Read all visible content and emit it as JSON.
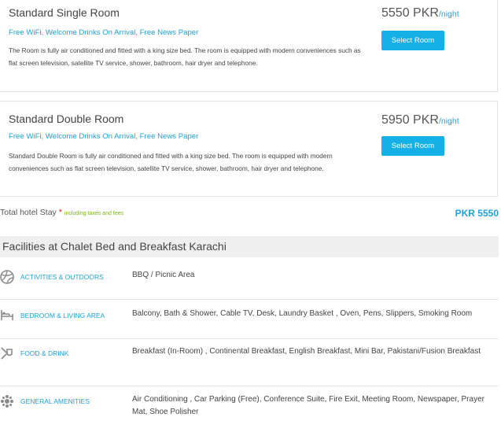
{
  "rooms": [
    {
      "name": "Standard Single Room",
      "amenities": "Free WiFi, Welcome Drinks On Arrival, Free News Paper",
      "description": "The Room is fully air conditioned and fitted with a king size bed. The room is equipped with modern conveniences such as flat screen television, satellite TV service, shower, bathroom, hair dryer and telephone.",
      "price": "5550 PKR",
      "per": "/night",
      "button": "Select Room"
    },
    {
      "name": "Standard Double Room",
      "amenities": "Free WiFi, Welcome Drinks On Arrival, Free News Paper",
      "description": "Standard Double Room is fully air conditioned and fitted with a king size bed. The room is equipped with modern conveniences such as flat screen television, satellite TV service, shower, bathroom, hair dryer and telephone.",
      "price": "5950 PKR",
      "per": "/night",
      "button": "Select Room"
    }
  ],
  "total": {
    "label": "Total hotel Stay",
    "star": "*",
    "note": "including taxes and fees",
    "value": "PKR 5550"
  },
  "facilities": {
    "title": "Facilities at Chalet Bed and Breakfast Karachi",
    "categories": [
      {
        "icon": "beach-ball-icon",
        "name": "ACTIVITIES & OUTDOORS",
        "items": "BBQ / Picnic Area"
      },
      {
        "icon": "bed-icon",
        "name": "BEDROOM & LIVING AREA",
        "items": "Balcony, Bath & Shower, Cable TV, Desk, Laundry Basket , Oven, Pens, Slippers, Smoking Room"
      },
      {
        "icon": "food-icon",
        "name": "FOOD & DRINK",
        "items": "Breakfast (In-Room) , Continental Breakfast, English Breakfast, Mini Bar, Pakistani/Fusion Breakfast"
      },
      {
        "icon": "amenities-icon",
        "name": "GENERAL AMENITIES",
        "items": "Air Conditioning , Car Parking (Free), Conference Suite, Fire Exit, Meeting Room, Newspaper, Prayer Mat, Shoe Polisher"
      }
    ]
  },
  "colors": {
    "accent": "#1fa2d6",
    "button": "#14b0e6",
    "note_green": "#7cb518",
    "star_red": "#d62b2b"
  }
}
